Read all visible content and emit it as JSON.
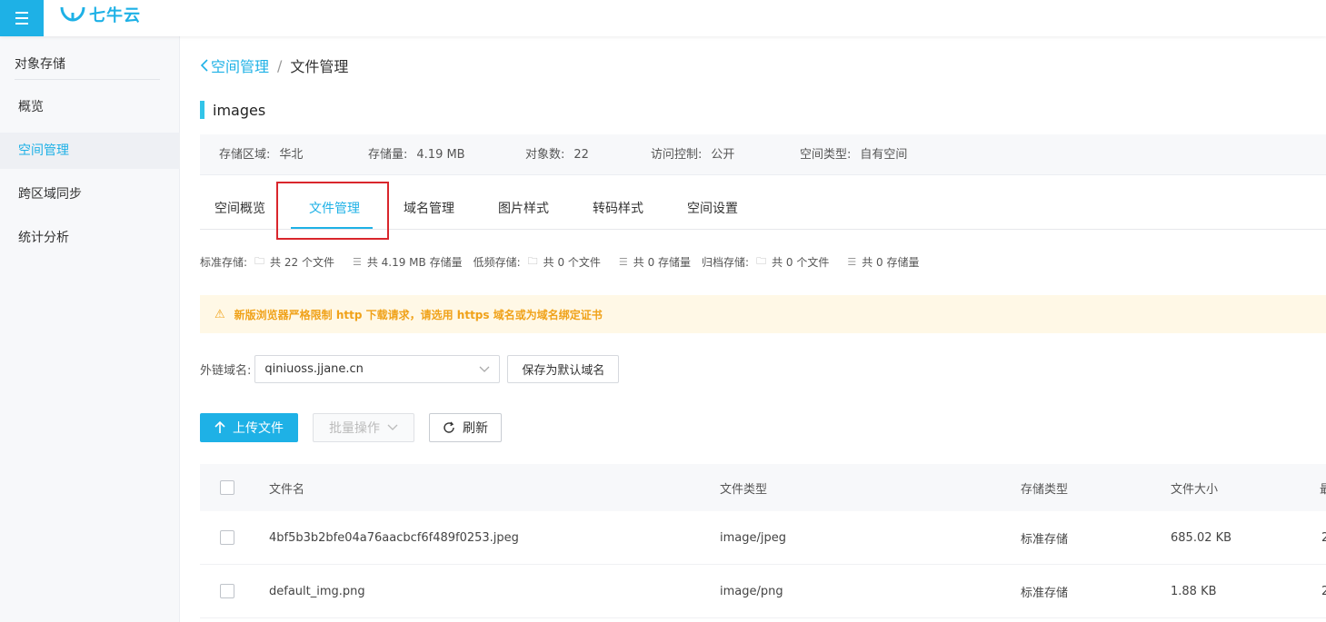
{
  "topbar": {
    "logo_text": "七牛云"
  },
  "sidebar": {
    "section_title": "对象存储",
    "items": [
      {
        "label": "概览",
        "active": false
      },
      {
        "label": "空间管理",
        "active": true
      },
      {
        "label": "跨区域同步",
        "active": false
      },
      {
        "label": "统计分析",
        "active": false
      }
    ]
  },
  "breadcrumb": {
    "back": "空间管理",
    "separator": "/",
    "current": "文件管理"
  },
  "bucket": {
    "name": "images"
  },
  "info": {
    "region_label": "存储区域:",
    "region_value": "华北",
    "storage_label": "存储量:",
    "storage_value": "4.19 MB",
    "objects_label": "对象数:",
    "objects_value": "22",
    "access_label": "访问控制:",
    "access_value": "公开",
    "type_label": "空间类型:",
    "type_value": "自有空间"
  },
  "tabs": [
    "空间概览",
    "文件管理",
    "域名管理",
    "图片样式",
    "转码样式",
    "空间设置"
  ],
  "stats": {
    "standard_label": "标准存储:",
    "standard_files": "共 22 个文件",
    "standard_size": "共 4.19 MB 存储量",
    "low_label": "低频存储:",
    "low_files": "共 0 个文件",
    "low_size": "共 0 存储量",
    "archive_label": "归档存储:",
    "archive_files": "共 0 个文件",
    "archive_size": "共 0 存储量"
  },
  "notice": "新版浏览器严格限制 http 下载请求，请选用 https 域名或为域名绑定证书",
  "domain": {
    "label": "外链域名:",
    "value": "qiniuoss.jjane.cn",
    "save_button": "保存为默认域名"
  },
  "actions": {
    "upload": "上传文件",
    "batch": "批量操作",
    "refresh": "刷新"
  },
  "table": {
    "headers": [
      "文件名",
      "文件类型",
      "存储类型",
      "文件大小",
      "最"
    ],
    "rows": [
      {
        "name": "4bf5b3b2bfe04a76aacbcf6f489f0253.jpeg",
        "type": "image/jpeg",
        "storage": "标准存储",
        "size": "685.02 KB",
        "extra": "2"
      },
      {
        "name": "default_img.png",
        "type": "image/png",
        "storage": "标准存储",
        "size": "1.88 KB",
        "extra": "2"
      }
    ]
  },
  "colors": {
    "brand": "#1eb1e6",
    "highlight": "#d9262c",
    "warning": "#f0a21a"
  }
}
